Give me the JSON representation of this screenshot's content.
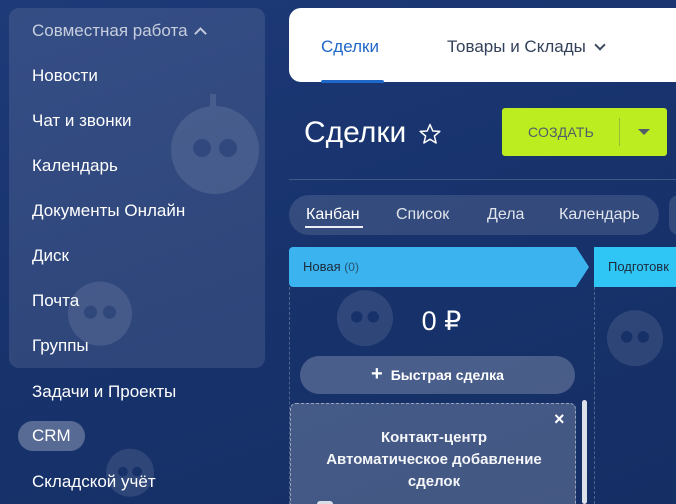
{
  "menu": {
    "group_header": "Совместная работа",
    "group_items": [
      {
        "label": "Новости"
      },
      {
        "label": "Чат и звонки"
      },
      {
        "label": "Календарь"
      },
      {
        "label": "Документы Онлайн"
      },
      {
        "label": "Диск"
      },
      {
        "label": "Почта"
      },
      {
        "label": "Группы"
      }
    ],
    "items": [
      {
        "label": "Задачи и Проекты"
      },
      {
        "label": "CRM",
        "active": true
      },
      {
        "label": "Складской учёт"
      }
    ]
  },
  "topbar": {
    "tabs": [
      {
        "label": "Сделки",
        "active": true
      },
      {
        "label": "Товары и Склады",
        "has_dropdown": true
      }
    ]
  },
  "page": {
    "title": "Сделки",
    "create_label": "СОЗДАТЬ"
  },
  "views": [
    {
      "label": "Канбан",
      "active": true
    },
    {
      "label": "Список"
    },
    {
      "label": "Дела"
    },
    {
      "label": "Календарь"
    }
  ],
  "kanban": {
    "columns": [
      {
        "title": "Новая",
        "count": "(0)",
        "color": "#3bb3ee"
      },
      {
        "title": "Подготовк",
        "color": "#2fc6f6"
      }
    ],
    "sum": "0 ₽",
    "quick_deal_label": "Быстрая сделка",
    "card": {
      "title_lines": [
        "Контакт-центр",
        "Автоматическое добавление",
        "сделок"
      ]
    }
  },
  "colors": {
    "accent_blue": "#1f67c8",
    "create_button": "#bbed21",
    "background": "#18336d"
  }
}
